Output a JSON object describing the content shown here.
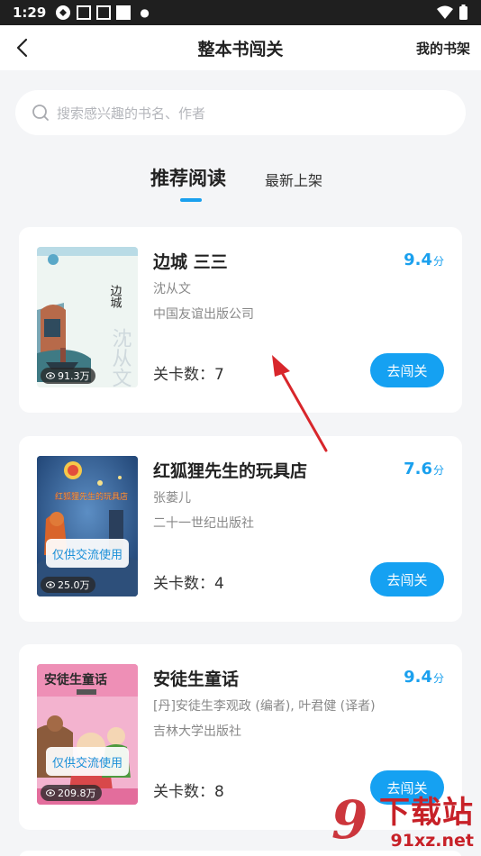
{
  "status_bar": {
    "time": "1:29"
  },
  "nav": {
    "title": "整本书闯关",
    "shelf_label": "我的书架"
  },
  "search": {
    "placeholder": "搜索感兴趣的书名、作者"
  },
  "tabs": [
    {
      "label": "推荐阅读",
      "active": true
    },
    {
      "label": "最新上架",
      "active": false
    }
  ],
  "books": [
    {
      "title": "边城 三三",
      "author": "沈从文",
      "publisher": "中国友谊出版公司",
      "score": "9.4",
      "score_unit": "分",
      "levels": "关卡数：7",
      "views": "91.3万",
      "button": "去闯关",
      "cover_text": "边城",
      "cover_sub": "沈从文"
    },
    {
      "title": "红狐狸先生的玩具店",
      "author": "张蒌儿",
      "publisher": "二十一世纪出版社",
      "score": "7.6",
      "score_unit": "分",
      "levels": "关卡数：4",
      "views": "25.0万",
      "button": "去闯关",
      "watermark": "仅供交流使用",
      "cover_text": "红狐狸先生的玩具店"
    },
    {
      "title": "安徒生童话",
      "author": "[丹]安徒生李观政 (编者), 叶君健 (译者)",
      "publisher": "吉林大学出版社",
      "score": "9.4",
      "score_unit": "分",
      "levels": "关卡数：8",
      "views": "209.8万",
      "button": "去闯关",
      "watermark": "仅供交流使用",
      "cover_text": "安徒生童话"
    }
  ],
  "site_watermark": {
    "number": "9",
    "name": "下载站",
    "domain": "91xz.net"
  },
  "colors": {
    "accent": "#15a1f2",
    "status_bar": "#1f1f1f",
    "background": "#f4f5f7",
    "arrow": "#d8262b"
  }
}
